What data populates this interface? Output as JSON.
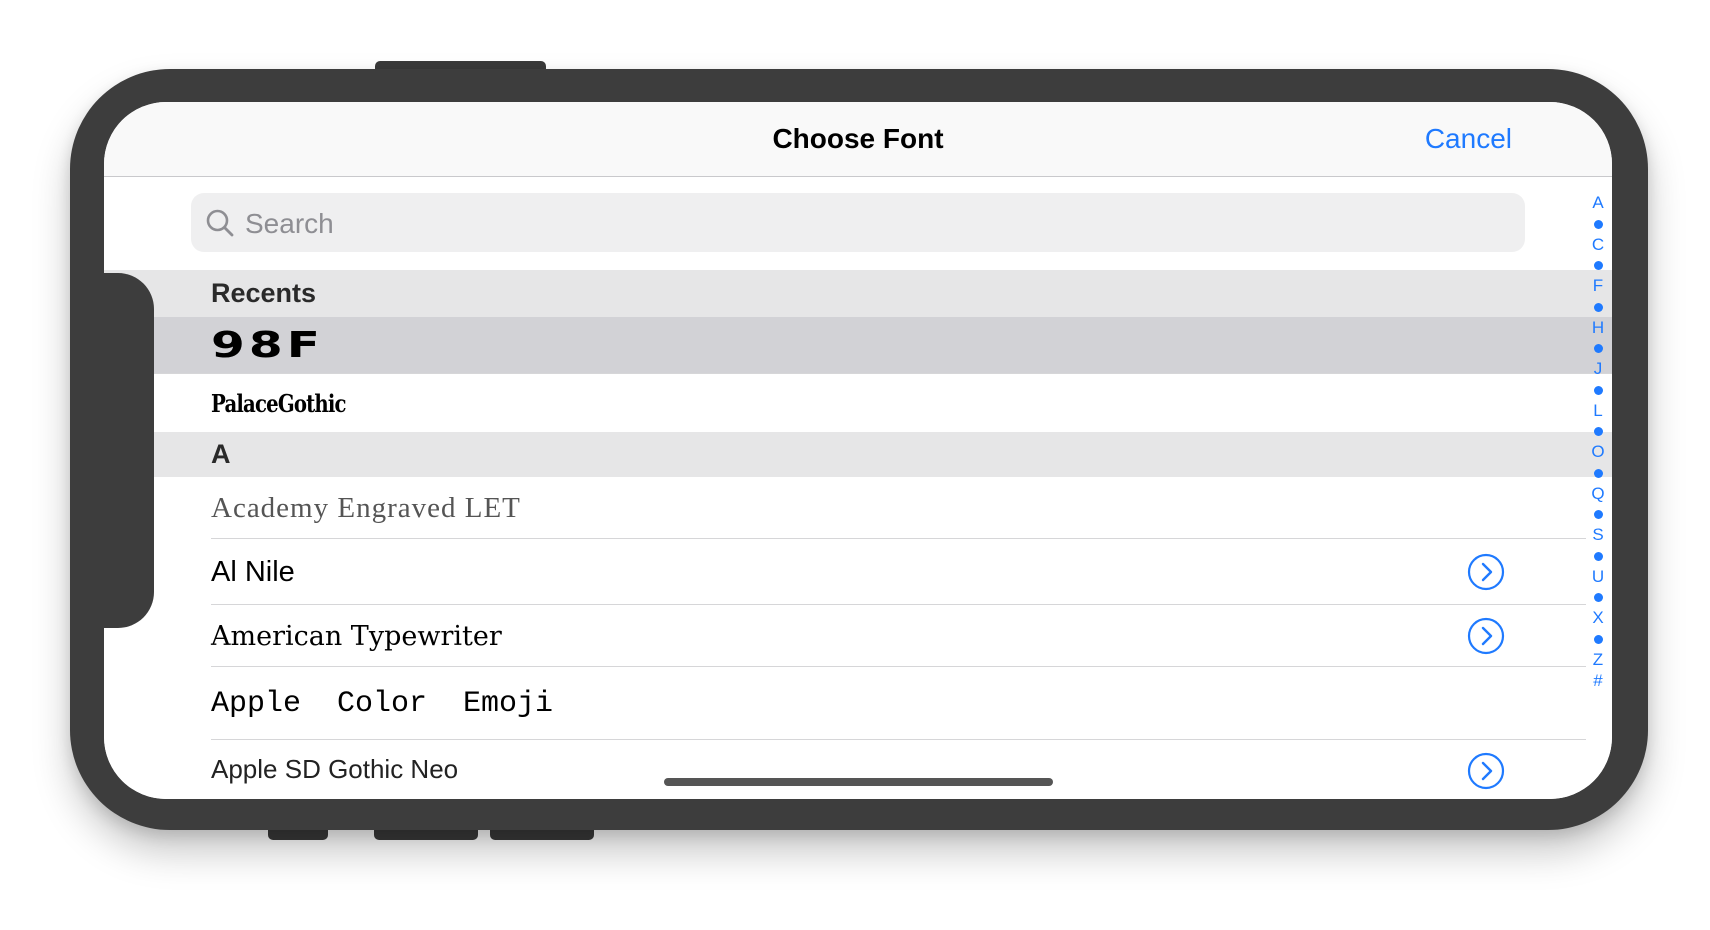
{
  "navbar": {
    "title": "Choose Font",
    "cancel_label": "Cancel"
  },
  "search": {
    "placeholder": "Search",
    "value": ""
  },
  "sections": {
    "recents": {
      "header": "Recents",
      "items": [
        {
          "label": "98F",
          "selected": true,
          "has_detail": false
        },
        {
          "label": "PalaceGothic",
          "selected": false,
          "has_detail": false
        }
      ]
    },
    "a": {
      "header": "A",
      "items": [
        {
          "label": "Academy Engraved LET",
          "has_detail": false
        },
        {
          "label": "Al Nile",
          "has_detail": true
        },
        {
          "label": "American Typewriter",
          "has_detail": true
        },
        {
          "label": "Apple Color Emoji",
          "has_detail": false
        },
        {
          "label": "Apple SD Gothic Neo",
          "has_detail": true
        }
      ]
    }
  },
  "index": {
    "letters": [
      "A",
      "C",
      "F",
      "H",
      "J",
      "L",
      "O",
      "Q",
      "S",
      "U",
      "X",
      "Z",
      "#"
    ]
  },
  "colors": {
    "accent": "#1f7aff",
    "section_bg": "#e6e6e7",
    "selected_bg": "#d2d2d6",
    "device_frame": "#3d3d3d"
  },
  "icons": {
    "search": "magnifying-glass",
    "detail": "chevron-right-circle"
  }
}
